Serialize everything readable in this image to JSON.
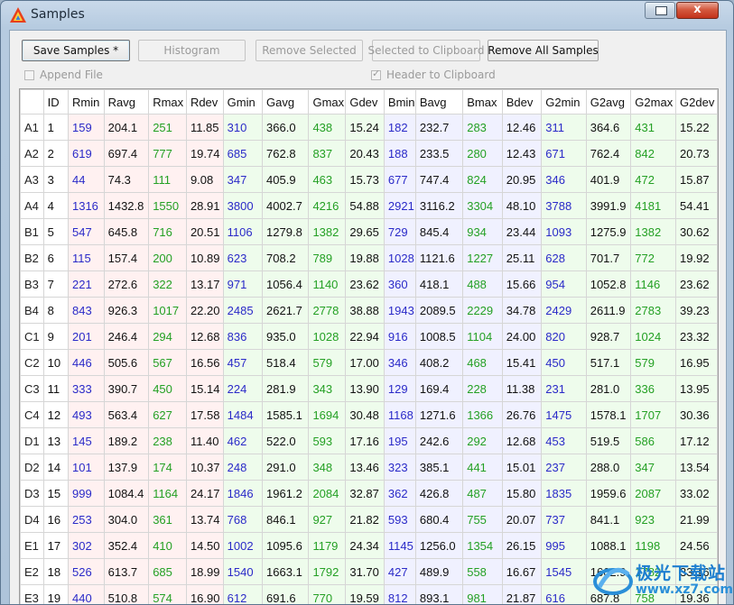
{
  "window": {
    "title": "Samples"
  },
  "titlebar": {
    "close_label": "x"
  },
  "toolbar": {
    "save_samples": "Save Samples *",
    "histogram": "Histogram",
    "remove_selected": "Remove Selected",
    "selected_to_clipboard": "Selected to Clipboard",
    "remove_all_samples": "Remove All Samples"
  },
  "options": {
    "append_file": {
      "label": "Append File",
      "checked": false
    },
    "header_to_clipboard": {
      "label": "Header to Clipboard",
      "checked": true
    }
  },
  "table": {
    "columns": [
      "",
      "ID",
      "Rmin",
      "Ravg",
      "Rmax",
      "Rdev",
      "Gmin",
      "Gavg",
      "Gmax",
      "Gdev",
      "Bmin",
      "Bavg",
      "Bmax",
      "Bdev",
      "G2min",
      "G2avg",
      "G2max",
      "G2dev"
    ],
    "rows": [
      [
        "A1",
        "1",
        "159",
        "204.1",
        "251",
        "11.85",
        "310",
        "366.0",
        "438",
        "15.24",
        "182",
        "232.7",
        "283",
        "12.46",
        "311",
        "364.6",
        "431",
        "15.22"
      ],
      [
        "A2",
        "2",
        "619",
        "697.4",
        "777",
        "19.74",
        "685",
        "762.8",
        "837",
        "20.43",
        "188",
        "233.5",
        "280",
        "12.43",
        "671",
        "762.4",
        "842",
        "20.73"
      ],
      [
        "A3",
        "3",
        "44",
        "74.3",
        "111",
        "9.08",
        "347",
        "405.9",
        "463",
        "15.73",
        "677",
        "747.4",
        "824",
        "20.95",
        "346",
        "401.9",
        "472",
        "15.87"
      ],
      [
        "A4",
        "4",
        "1316",
        "1432.8",
        "1550",
        "28.91",
        "3800",
        "4002.7",
        "4216",
        "54.88",
        "2921",
        "3116.2",
        "3304",
        "48.10",
        "3788",
        "3991.9",
        "4181",
        "54.41"
      ],
      [
        "B1",
        "5",
        "547",
        "645.8",
        "716",
        "20.51",
        "1106",
        "1279.8",
        "1382",
        "29.65",
        "729",
        "845.4",
        "934",
        "23.44",
        "1093",
        "1275.9",
        "1382",
        "30.62"
      ],
      [
        "B2",
        "6",
        "115",
        "157.4",
        "200",
        "10.89",
        "623",
        "708.2",
        "789",
        "19.88",
        "1028",
        "1121.6",
        "1227",
        "25.11",
        "628",
        "701.7",
        "772",
        "19.92"
      ],
      [
        "B3",
        "7",
        "221",
        "272.6",
        "322",
        "13.17",
        "971",
        "1056.4",
        "1140",
        "23.62",
        "360",
        "418.1",
        "488",
        "15.66",
        "954",
        "1052.8",
        "1146",
        "23.62"
      ],
      [
        "B4",
        "8",
        "843",
        "926.3",
        "1017",
        "22.20",
        "2485",
        "2621.7",
        "2778",
        "38.88",
        "1943",
        "2089.5",
        "2229",
        "34.78",
        "2429",
        "2611.9",
        "2783",
        "39.23"
      ],
      [
        "C1",
        "9",
        "201",
        "246.4",
        "294",
        "12.68",
        "836",
        "935.0",
        "1028",
        "22.94",
        "916",
        "1008.5",
        "1104",
        "24.00",
        "820",
        "928.7",
        "1024",
        "23.32"
      ],
      [
        "C2",
        "10",
        "446",
        "505.6",
        "567",
        "16.56",
        "457",
        "518.4",
        "579",
        "17.00",
        "346",
        "408.2",
        "468",
        "15.41",
        "450",
        "517.1",
        "579",
        "16.95"
      ],
      [
        "C3",
        "11",
        "333",
        "390.7",
        "450",
        "15.14",
        "224",
        "281.9",
        "343",
        "13.90",
        "129",
        "169.4",
        "228",
        "11.38",
        "231",
        "281.0",
        "336",
        "13.95"
      ],
      [
        "C4",
        "12",
        "493",
        "563.4",
        "627",
        "17.58",
        "1484",
        "1585.1",
        "1694",
        "30.48",
        "1168",
        "1271.6",
        "1366",
        "26.76",
        "1475",
        "1578.1",
        "1707",
        "30.36"
      ],
      [
        "D1",
        "13",
        "145",
        "189.2",
        "238",
        "11.40",
        "462",
        "522.0",
        "593",
        "17.16",
        "195",
        "242.6",
        "292",
        "12.68",
        "453",
        "519.5",
        "586",
        "17.12"
      ],
      [
        "D2",
        "14",
        "101",
        "137.9",
        "174",
        "10.37",
        "248",
        "291.0",
        "348",
        "13.46",
        "323",
        "385.1",
        "441",
        "15.01",
        "237",
        "288.0",
        "347",
        "13.54"
      ],
      [
        "D3",
        "15",
        "999",
        "1084.4",
        "1164",
        "24.17",
        "1846",
        "1961.2",
        "2084",
        "32.87",
        "362",
        "426.8",
        "487",
        "15.80",
        "1835",
        "1959.6",
        "2087",
        "33.02"
      ],
      [
        "D4",
        "16",
        "253",
        "304.0",
        "361",
        "13.74",
        "768",
        "846.1",
        "927",
        "21.82",
        "593",
        "680.4",
        "755",
        "20.07",
        "737",
        "841.1",
        "923",
        "21.99"
      ],
      [
        "E1",
        "17",
        "302",
        "352.4",
        "410",
        "14.50",
        "1002",
        "1095.6",
        "1179",
        "24.34",
        "1145",
        "1256.0",
        "1354",
        "26.15",
        "995",
        "1088.1",
        "1198",
        "24.56"
      ],
      [
        "E2",
        "18",
        "526",
        "613.7",
        "685",
        "18.99",
        "1540",
        "1663.1",
        "1792",
        "31.70",
        "427",
        "489.9",
        "558",
        "16.67",
        "1545",
        "1662.9",
        "1782",
        "33.16"
      ],
      [
        "E3",
        "19",
        "440",
        "510.8",
        "574",
        "16.90",
        "612",
        "691.6",
        "770",
        "19.59",
        "812",
        "893.1",
        "981",
        "21.87",
        "616",
        "687.8",
        "758",
        "19.36"
      ]
    ]
  },
  "watermark": {
    "text": "极光下载站",
    "url": "www.xz7.com"
  },
  "colors": {
    "min_text": "#2a2ac8",
    "max_text": "#24a024",
    "r_bg": "#fff1f1",
    "g_bg": "#eefcec",
    "b_bg": "#f0f1ff"
  }
}
